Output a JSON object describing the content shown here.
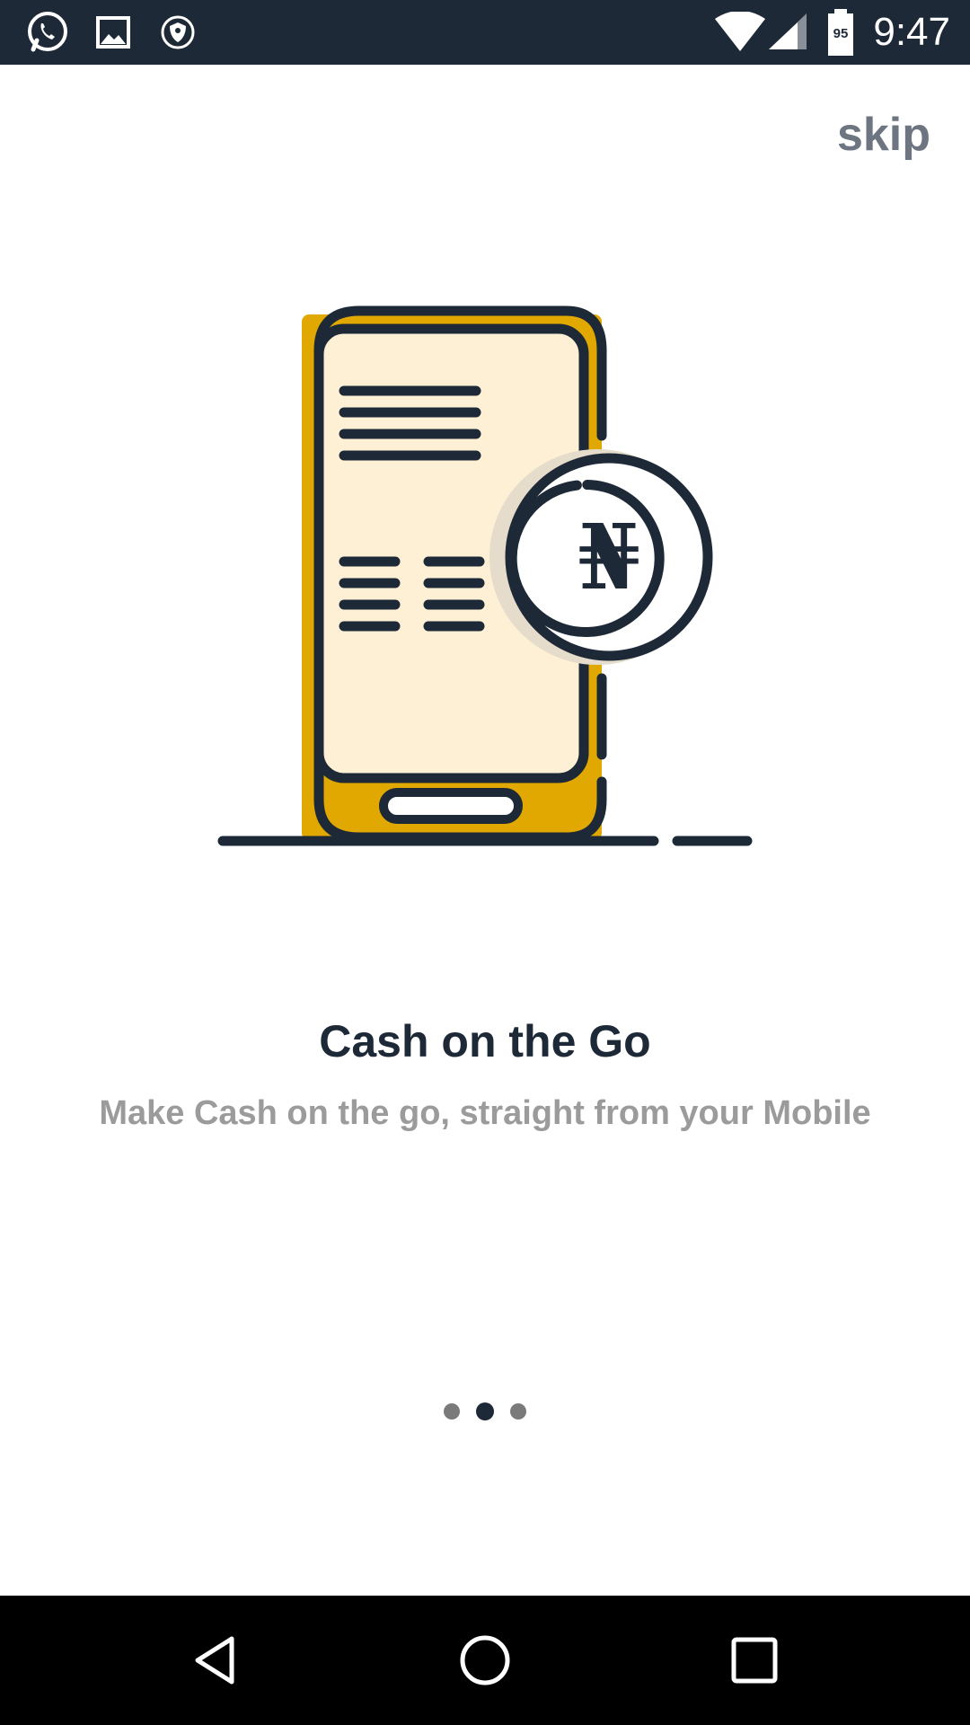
{
  "status_bar": {
    "time": "9:47",
    "battery_level": "95",
    "icons": [
      "whatsapp-icon",
      "gallery-icon",
      "vpn-shield-icon",
      "wifi-icon",
      "signal-icon",
      "battery-icon"
    ]
  },
  "onboarding": {
    "skip_label": "skip",
    "currency_symbol": "₦",
    "title": "Cash on the Go",
    "subtitle": "Make Cash on the go, straight from your Mobile",
    "page_count": 3,
    "active_page": 2
  },
  "nav_bar": {
    "icons": [
      "back-icon",
      "home-icon",
      "recents-icon"
    ]
  },
  "colors": {
    "status_bar": "#1e2938",
    "accent": "#e0a800",
    "screen_fill": "#fdf0d5",
    "text_dark": "#1e2938",
    "text_muted": "#9b9b9b"
  }
}
